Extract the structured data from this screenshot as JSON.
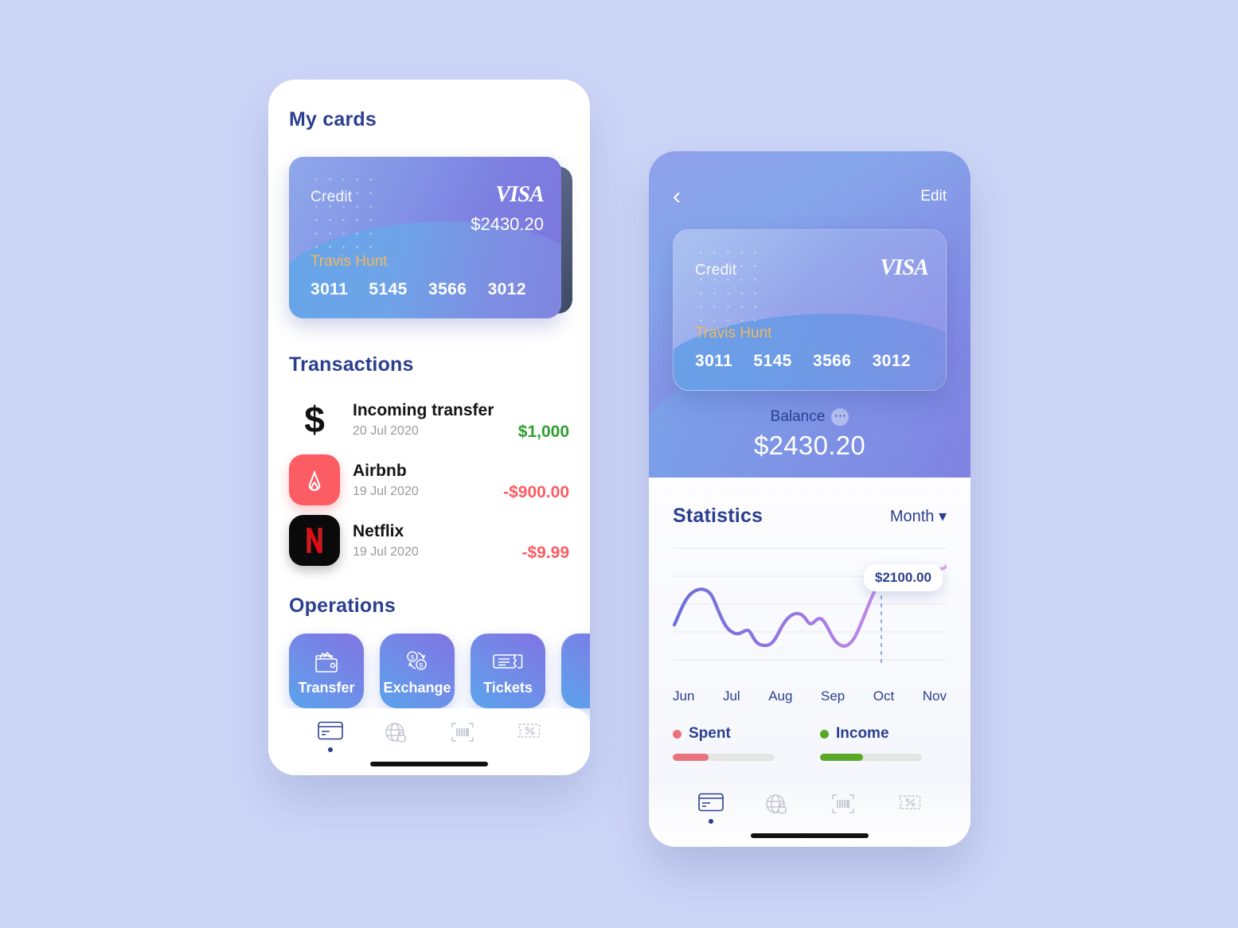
{
  "background_color": "#ccd6f7",
  "card_screen": {
    "title": "My cards",
    "card": {
      "type_label": "Credit",
      "brand": "VISA",
      "amount": "$2430.20",
      "holder": "Travis Hunt",
      "number_groups": [
        "3011",
        "5145",
        "3566",
        "3012"
      ],
      "gradient_from": "#8fa7ea",
      "gradient_to": "#7b74dd",
      "holder_color": "#f0b860"
    },
    "transactions": {
      "title": "Transactions",
      "items": [
        {
          "icon": "dollar-icon",
          "name": "Incoming transfer",
          "date": "20 Jul 2020",
          "amount": "$1,000",
          "sign": "pos",
          "color": "#2f9e2f"
        },
        {
          "icon": "airbnb-icon",
          "name": "Airbnb",
          "date": "19 Jul 2020",
          "amount": "-$900.00",
          "sign": "neg",
          "color": "#fc5c63"
        },
        {
          "icon": "netflix-icon",
          "name": "Netflix",
          "date": "19 Jul 2020",
          "amount": "-$9.99",
          "sign": "neg",
          "color": "#fc5c63"
        }
      ]
    },
    "operations": {
      "title": "Operations",
      "items": [
        {
          "label": "Transfer",
          "icon": "wallet-icon"
        },
        {
          "label": "Exchange",
          "icon": "currency-exchange-icon"
        },
        {
          "label": "Tickets",
          "icon": "ticket-icon"
        },
        {
          "label": "",
          "icon": "partial-tile-icon"
        }
      ]
    },
    "bottom_nav": [
      {
        "icon": "credit-card-icon",
        "active": true
      },
      {
        "icon": "globe-lock-icon",
        "active": false
      },
      {
        "icon": "barcode-scan-icon",
        "active": false
      },
      {
        "icon": "discount-ticket-icon",
        "active": false
      }
    ]
  },
  "detail_screen": {
    "back_icon": "chevron-left-icon",
    "edit_label": "Edit",
    "card": {
      "type_label": "Credit",
      "brand": "VISA",
      "holder": "Travis Hunt",
      "number_groups": [
        "3011",
        "5145",
        "3566",
        "3012"
      ]
    },
    "balance_label": "Balance",
    "balance_more_icon": "ellipsis-icon",
    "balance_amount": "$2430.20",
    "statistics": {
      "title": "Statistics",
      "period_selector": "Month ▾",
      "tooltip_value": "$2100.00",
      "legend": [
        {
          "label": "Spent",
          "color": "#e8737a",
          "progress": 35
        },
        {
          "label": "Income",
          "color": "#5aa828",
          "progress": 42
        }
      ]
    },
    "bottom_nav": [
      {
        "icon": "credit-card-icon",
        "active": true
      },
      {
        "icon": "globe-lock-icon",
        "active": false
      },
      {
        "icon": "barcode-scan-icon",
        "active": false
      },
      {
        "icon": "discount-ticket-icon",
        "active": false
      }
    ]
  },
  "chart_data": {
    "type": "line",
    "title": "Statistics",
    "xlabel": "",
    "ylabel": "",
    "categories": [
      "Jun",
      "Jul",
      "Aug",
      "Sep",
      "Oct",
      "Nov"
    ],
    "x": [
      0,
      1,
      2,
      3,
      4,
      5
    ],
    "ylim": [
      0,
      2600
    ],
    "grid": true,
    "gridlines": 5,
    "legend_position": "bottom",
    "line_gradient": [
      "#6a6fdb",
      "#c79ae8"
    ],
    "highlight": {
      "x_label": "Oct",
      "value": 2100,
      "marker": "circle",
      "tooltip": "$2100.00"
    },
    "series": [
      {
        "name": "Balance",
        "values": [
          1350,
          1750,
          1700,
          1050,
          980,
          820,
          860,
          1300,
          1400,
          1250,
          1270,
          900,
          840,
          1200,
          2100,
          2350,
          2480,
          2350,
          2400,
          2500
        ]
      }
    ],
    "tick_labels": [
      "Jun",
      "Jul",
      "Aug",
      "Sep",
      "Oct",
      "Nov"
    ]
  }
}
